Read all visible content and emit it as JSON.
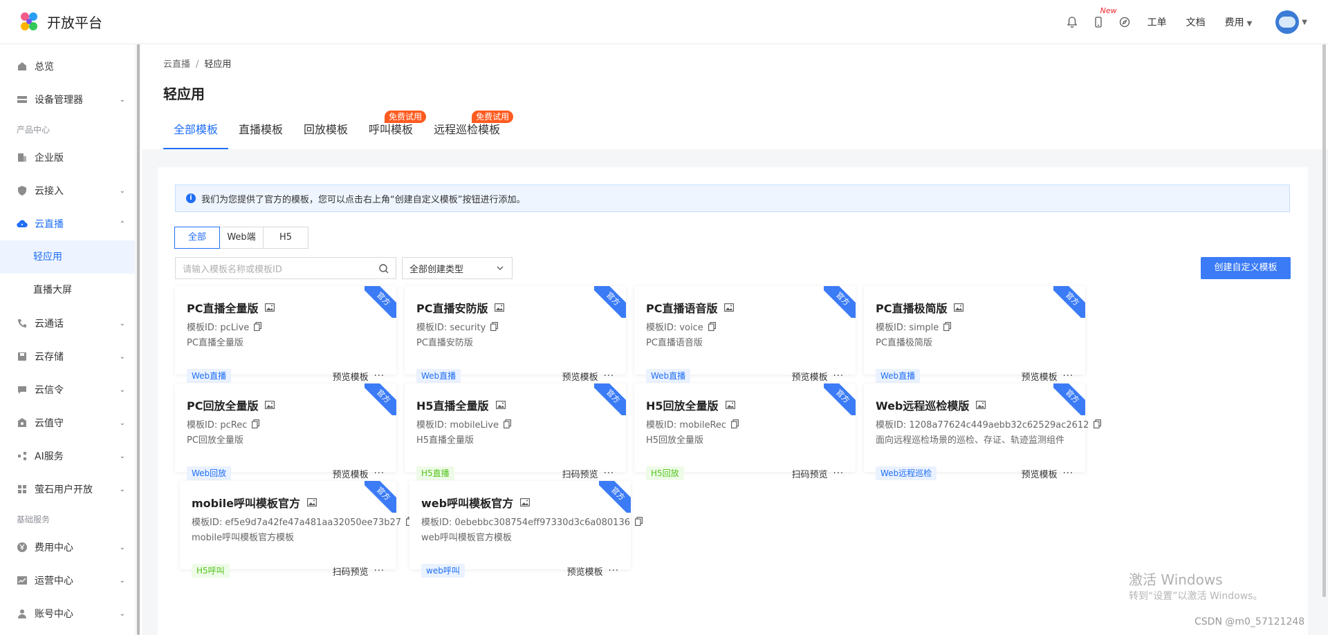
{
  "header": {
    "logo_text": "开放平台",
    "new_badge": "New",
    "links": [
      "工单",
      "文档",
      "费用"
    ]
  },
  "sidebar": {
    "items_top": [
      {
        "label": "总览",
        "icon": "home-icon",
        "arrow": ""
      },
      {
        "label": "设备管理器",
        "icon": "device-icon",
        "arrow": "⌄"
      }
    ],
    "group_product": "产品中心",
    "items_product": [
      {
        "label": "企业版",
        "icon": "building-icon",
        "arrow": ""
      },
      {
        "label": "云接入",
        "icon": "shield-icon",
        "arrow": "⌄"
      },
      {
        "label": "云直播",
        "icon": "cloud-live-icon",
        "arrow": "⌃",
        "active": true
      }
    ],
    "sub_items": [
      {
        "label": "轻应用",
        "active": true
      },
      {
        "label": "直播大屏",
        "active": false
      }
    ],
    "items_product2": [
      {
        "label": "云通话",
        "icon": "phone-icon",
        "arrow": "⌄"
      },
      {
        "label": "云存储",
        "icon": "storage-icon",
        "arrow": "⌄"
      },
      {
        "label": "云信令",
        "icon": "message-icon",
        "arrow": "⌄"
      },
      {
        "label": "云值守",
        "icon": "guard-icon",
        "arrow": "⌄"
      },
      {
        "label": "AI服务",
        "icon": "ai-icon",
        "arrow": "⌄"
      },
      {
        "label": "萤石用户开放",
        "icon": "user-open-icon",
        "arrow": "⌄"
      }
    ],
    "group_base": "基础服务",
    "items_base": [
      {
        "label": "费用中心",
        "icon": "yen-icon",
        "arrow": "⌄"
      },
      {
        "label": "运营中心",
        "icon": "chart-icon",
        "arrow": "⌄"
      },
      {
        "label": "账号中心",
        "icon": "account-icon",
        "arrow": "⌄"
      }
    ]
  },
  "page": {
    "breadcrumb_parent": "云直播",
    "breadcrumb_sep": "/",
    "breadcrumb_current": "轻应用",
    "title": "轻应用",
    "tabs": [
      {
        "label": "全部模板",
        "badge": ""
      },
      {
        "label": "直播模板",
        "badge": ""
      },
      {
        "label": "回放模板",
        "badge": ""
      },
      {
        "label": "呼叫模板",
        "badge": "免费试用"
      },
      {
        "label": "远程巡检模板",
        "badge": "免费试用"
      }
    ],
    "notice": "我们为您提供了官方的模板，您可以点击右上角“创建自定义模板”按钮进行添加。",
    "segments": [
      "全部",
      "Web端",
      "H5"
    ],
    "search_placeholder": "请输入模板名称或模板ID",
    "select_value": "全部创建类型",
    "create_button": "创建自定义模板"
  },
  "cards": [
    {
      "title": "PC直播全量版",
      "id": "模板ID:  pcLive",
      "desc": "PC直播全量版",
      "tag": "Web直播",
      "tag_color": "blue",
      "action": "预览模板",
      "ribbon": "官方"
    },
    {
      "title": "PC直播安防版",
      "id": "模板ID:  security",
      "desc": "PC直播安防版",
      "tag": "Web直播",
      "tag_color": "blue",
      "action": "预览模板",
      "ribbon": "官方"
    },
    {
      "title": "PC直播语音版",
      "id": "模板ID:  voice",
      "desc": "PC直播语音版",
      "tag": "Web直播",
      "tag_color": "blue",
      "action": "预览模板",
      "ribbon": "官方"
    },
    {
      "title": "PC直播极简版",
      "id": "模板ID:  simple",
      "desc": "PC直播极简版",
      "tag": "Web直播",
      "tag_color": "blue",
      "action": "预览模板",
      "ribbon": "官方"
    },
    {
      "title": "PC回放全量版",
      "id": "模板ID:  pcRec",
      "desc": "PC回放全量版",
      "tag": "Web回放",
      "tag_color": "blue",
      "action": "预览模板",
      "ribbon": "官方"
    },
    {
      "title": "H5直播全量版",
      "id": "模板ID:  mobileLive",
      "desc": "H5直播全量版",
      "tag": "H5直播",
      "tag_color": "green",
      "action": "扫码预览",
      "ribbon": "官方"
    },
    {
      "title": "H5回放全量版",
      "id": "模板ID:  mobileRec",
      "desc": "H5回放全量版",
      "tag": "H5回放",
      "tag_color": "green",
      "action": "扫码预览",
      "ribbon": "官方"
    },
    {
      "title": "Web远程巡检模版",
      "id": "模板ID:  1208a77624c449aebb32c62529ac2612",
      "desc": "面向远程巡检场景的巡检、存证、轨迹监测组件",
      "tag": "Web远程巡检",
      "tag_color": "blue",
      "action": "预览模板",
      "ribbon": "官方"
    },
    {
      "title": "mobile呼叫模板官方",
      "id": "模板ID:  ef5e9d7a42fe47a481aa32050ee73b27",
      "desc": "mobile呼叫模板官方模板",
      "tag": "H5呼叫",
      "tag_color": "green",
      "action": "扫码预览",
      "ribbon": "官方"
    },
    {
      "title": "web呼叫模板官方",
      "id": "模板ID:  0ebebbc308754eff97330d3c6a080136",
      "desc": "web呼叫模板官方模板",
      "tag": "web呼叫",
      "tag_color": "blue",
      "action": "预览模板",
      "ribbon": "官方"
    }
  ],
  "more_glyph": "···",
  "watermark": {
    "line1": "激活 Windows",
    "line2": "转到“设置”以激活 Windows。"
  },
  "credit": "CSDN @m0_57121248",
  "colors": {
    "accent": "#1f6ef5",
    "button": "#3b7bf6",
    "badge": "#ff5a1f"
  }
}
